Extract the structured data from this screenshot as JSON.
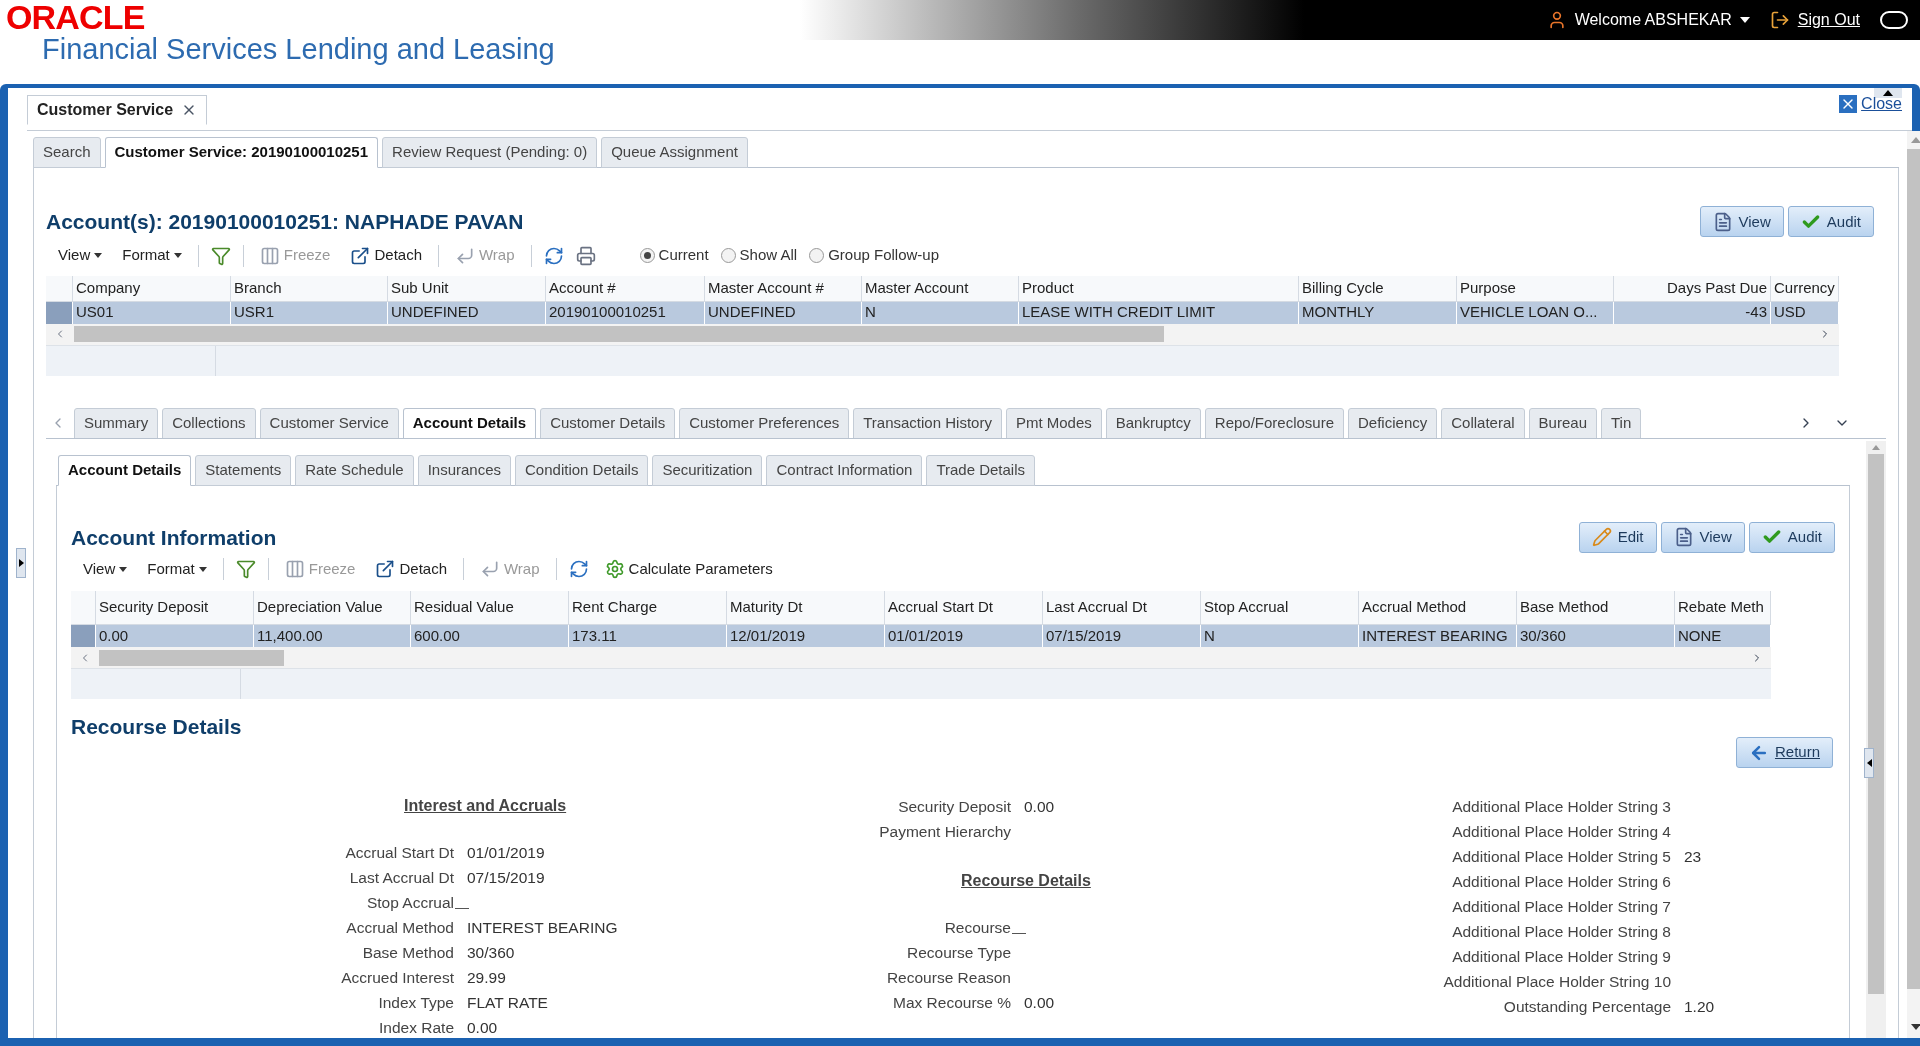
{
  "header": {
    "brand": "ORACLE",
    "product": "Financial Services Lending and Leasing",
    "welcome": "Welcome ABSHEKAR",
    "sign_out": "Sign Out"
  },
  "page_tab": {
    "label": "Customer Service",
    "close_label": "Close"
  },
  "top_tabs": [
    {
      "label": "Search",
      "selected": false
    },
    {
      "label": "Customer Service: 20190100010251",
      "selected": true
    },
    {
      "label": "Review Request (Pending: 0)",
      "selected": false
    },
    {
      "label": "Queue Assignment",
      "selected": false
    }
  ],
  "account": {
    "title": "Account(s): 20190100010251: NAPHADE PAVAN",
    "buttons": [
      {
        "label": "View",
        "kind": "view"
      },
      {
        "label": "Audit",
        "kind": "audit"
      }
    ],
    "toolbar": [
      {
        "kind": "menu",
        "label": "View"
      },
      {
        "kind": "menu",
        "label": "Format"
      },
      {
        "kind": "separator"
      },
      {
        "kind": "filter"
      },
      {
        "kind": "separator"
      },
      {
        "kind": "freeze",
        "label": "Freeze",
        "disabled": true
      },
      {
        "kind": "detach",
        "label": "Detach",
        "disabled": false
      },
      {
        "kind": "separator"
      },
      {
        "kind": "wrap",
        "label": "Wrap",
        "disabled": true
      },
      {
        "kind": "separator"
      },
      {
        "kind": "refresh"
      },
      {
        "kind": "print"
      }
    ],
    "radios": [
      {
        "label": "Current",
        "selected": true
      },
      {
        "label": "Show All",
        "selected": false
      },
      {
        "label": "Group Follow-up",
        "selected": false
      }
    ],
    "columns": [
      "Company",
      "Branch",
      "Sub Unit",
      "Account #",
      "Master Account #",
      "Master Account",
      "Product",
      "Billing Cycle",
      "Purpose",
      "Days Past Due",
      "Currency"
    ],
    "rows": [
      {
        "selected": true,
        "cells": [
          "US01",
          "USR1",
          "UNDEFINED",
          "20190100010251",
          "UNDEFINED",
          "N",
          "LEASE WITH CREDIT LIMIT",
          "MONTHLY",
          "VEHICLE LOAN O...",
          "-43",
          "USD"
        ]
      }
    ]
  },
  "section_tabs": [
    {
      "label": "Summary",
      "selected": false
    },
    {
      "label": "Collections",
      "selected": false
    },
    {
      "label": "Customer Service",
      "selected": false
    },
    {
      "label": "Account Details",
      "selected": true
    },
    {
      "label": "Customer Details",
      "selected": false
    },
    {
      "label": "Customer Preferences",
      "selected": false
    },
    {
      "label": "Transaction History",
      "selected": false
    },
    {
      "label": "Pmt Modes",
      "selected": false
    },
    {
      "label": "Bankruptcy",
      "selected": false
    },
    {
      "label": "Repo/Foreclosure",
      "selected": false
    },
    {
      "label": "Deficiency",
      "selected": false
    },
    {
      "label": "Collateral",
      "selected": false
    },
    {
      "label": "Bureau",
      "selected": false
    },
    {
      "label": "Tin",
      "selected": false
    }
  ],
  "sub_tabs": [
    {
      "label": "Account Details",
      "selected": true
    },
    {
      "label": "Statements",
      "selected": false
    },
    {
      "label": "Rate Schedule",
      "selected": false
    },
    {
      "label": "Insurances",
      "selected": false
    },
    {
      "label": "Condition Details",
      "selected": false
    },
    {
      "label": "Securitization",
      "selected": false
    },
    {
      "label": "Contract Information",
      "selected": false
    },
    {
      "label": "Trade Details",
      "selected": false
    }
  ],
  "account_information": {
    "title": "Account Information",
    "buttons": [
      {
        "label": "Edit",
        "kind": "edit"
      },
      {
        "label": "View",
        "kind": "view"
      },
      {
        "label": "Audit",
        "kind": "audit"
      }
    ],
    "toolbar": [
      {
        "kind": "menu",
        "label": "View"
      },
      {
        "kind": "menu",
        "label": "Format"
      },
      {
        "kind": "separator"
      },
      {
        "kind": "filter"
      },
      {
        "kind": "separator"
      },
      {
        "kind": "freeze",
        "label": "Freeze",
        "disabled": true
      },
      {
        "kind": "detach",
        "label": "Detach",
        "disabled": false
      },
      {
        "kind": "separator"
      },
      {
        "kind": "wrap",
        "label": "Wrap",
        "disabled": true
      },
      {
        "kind": "separator"
      },
      {
        "kind": "refresh"
      },
      {
        "kind": "gear",
        "label": "Calculate Parameters",
        "disabled": false
      }
    ],
    "columns": [
      "Security Deposit",
      "Depreciation Value",
      "Residual Value",
      "Rent Charge",
      "Maturity Dt",
      "Accrual Start Dt",
      "Last Accrual Dt",
      "Stop Accrual",
      "Accrual Method",
      "Base Method",
      "Rebate Meth"
    ],
    "rows": [
      {
        "selected": true,
        "cells": [
          "0.00",
          "11,400.00",
          "600.00",
          "173.11",
          "12/01/2019",
          "01/01/2019",
          "07/15/2019",
          "N",
          "INTEREST BEARING",
          "30/360",
          "NONE"
        ]
      }
    ]
  },
  "recourse_details": {
    "title": "Recourse Details",
    "return_label": "Return",
    "columns": [
      {
        "sections": [
          {
            "heading": "Interest and Accruals",
            "fields": [
              {
                "label": "Accrual Start Dt",
                "value": "01/01/2019"
              },
              {
                "label": "Last Accrual Dt",
                "value": "07/15/2019"
              },
              {
                "label": "Stop Accrual",
                "kind": "blank"
              },
              {
                "label": "Accrual Method",
                "value": "INTEREST BEARING"
              },
              {
                "label": "Base Method",
                "value": "30/360"
              },
              {
                "label": "Accrued Interest",
                "value": "29.99"
              },
              {
                "label": "Index Type",
                "value": "FLAT RATE"
              },
              {
                "label": "Index Rate",
                "value": "0.00"
              }
            ]
          }
        ]
      },
      {
        "sections": [
          {
            "fields": [
              {
                "label": "Security Deposit",
                "value": "0.00"
              },
              {
                "label": "Payment Hierarchy"
              }
            ]
          },
          {
            "heading": "Recourse Details",
            "fields": [
              {
                "label": "Recourse",
                "kind": "blank"
              },
              {
                "label": "Recourse Type"
              },
              {
                "label": "Recourse Reason"
              },
              {
                "label": "Max Recourse %",
                "value": "0.00"
              }
            ]
          }
        ]
      },
      {
        "sections": [
          {
            "fields": [
              {
                "label": "Additional Place Holder String 3"
              },
              {
                "label": "Additional Place Holder String 4"
              },
              {
                "label": "Additional Place Holder String 5",
                "value": "23"
              },
              {
                "label": "Additional Place Holder String 6"
              },
              {
                "label": "Additional Place Holder String 7"
              },
              {
                "label": "Additional Place Holder String 8"
              },
              {
                "label": "Additional Place Holder String 9"
              },
              {
                "label": "Additional Place Holder String 10"
              },
              {
                "label": "Outstanding Percentage",
                "value": "1.20"
              }
            ]
          }
        ]
      }
    ]
  }
}
